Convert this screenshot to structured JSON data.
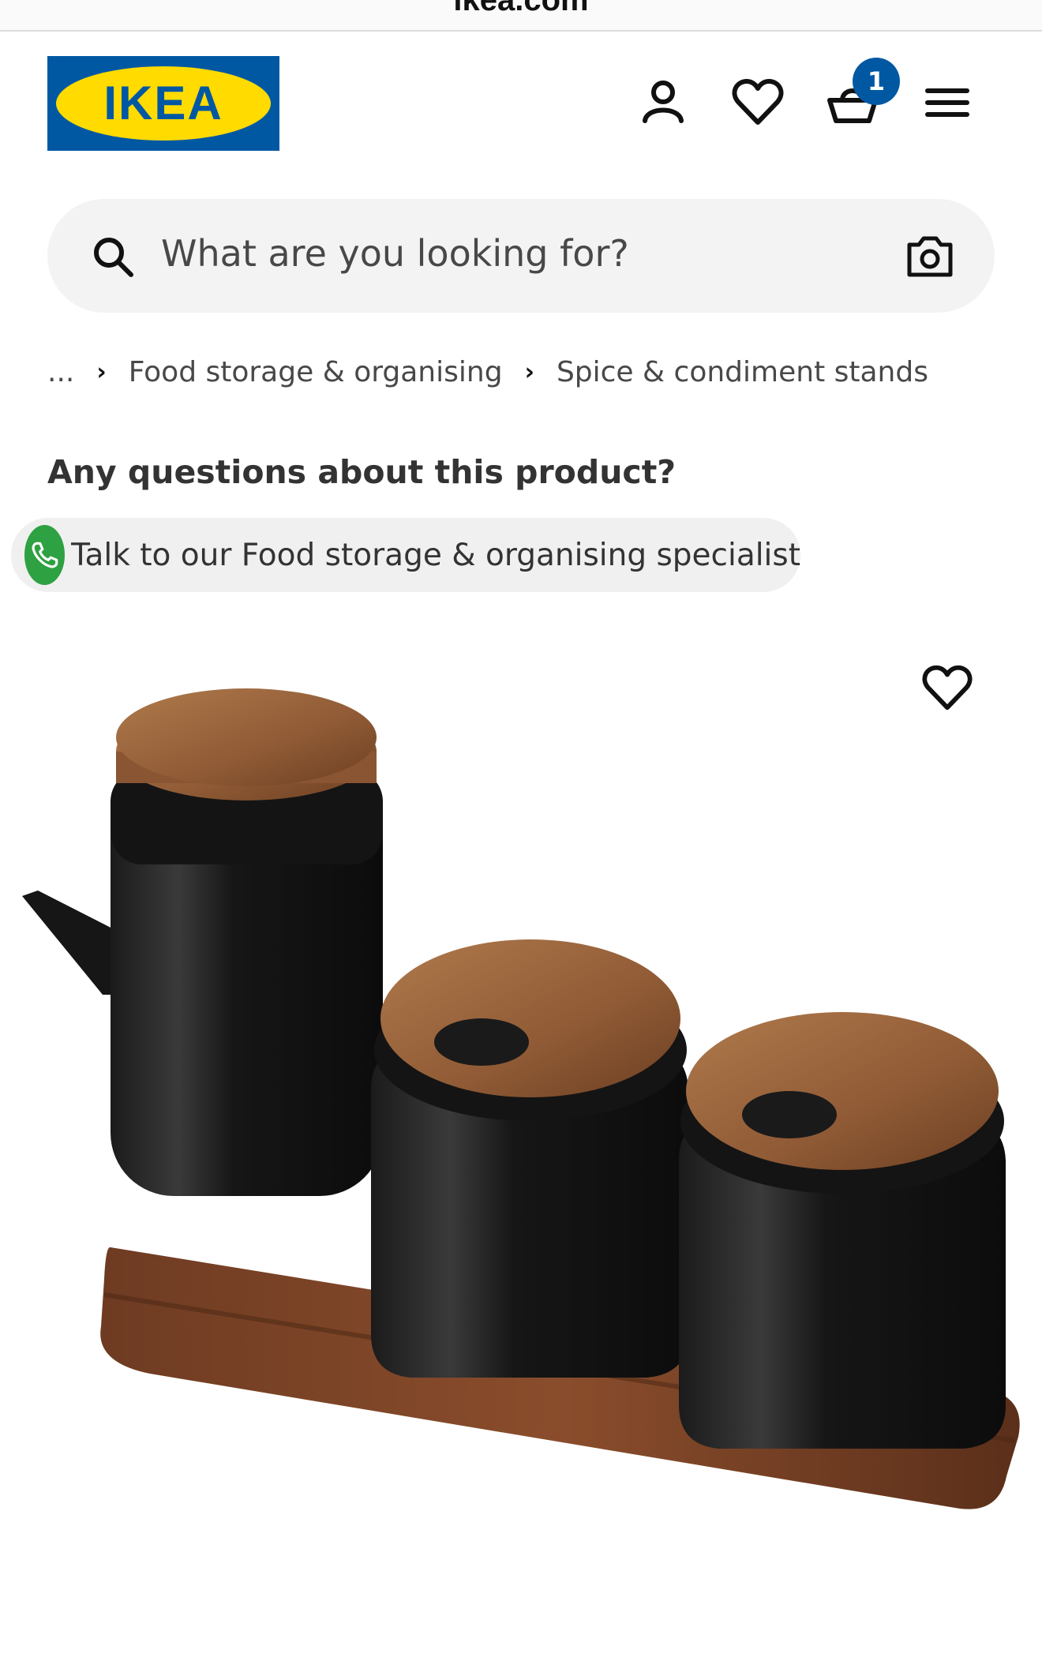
{
  "browser": {
    "url": "ikea.com"
  },
  "header": {
    "logo_text": "IKEA",
    "brand_colors": {
      "blue": "#0058a3",
      "yellow": "#ffdb00"
    },
    "icons": [
      "profile-icon",
      "heart-icon",
      "cart-icon",
      "menu-icon"
    ],
    "cart_count": "1"
  },
  "search": {
    "placeholder": "What are you looking for?",
    "icons": [
      "search-icon",
      "camera-icon"
    ]
  },
  "breadcrumb": {
    "items": [
      "...",
      "Food storage & organising",
      "Spice & condiment stands"
    ]
  },
  "questions": {
    "title": "Any questions about this product?",
    "talk_label": "Talk to our Food storage & organising specialist",
    "phone_color": "#2ea142"
  },
  "product": {
    "image": "Black ceramic oil bottle and two jars with wooden lids on a wooden tray"
  }
}
